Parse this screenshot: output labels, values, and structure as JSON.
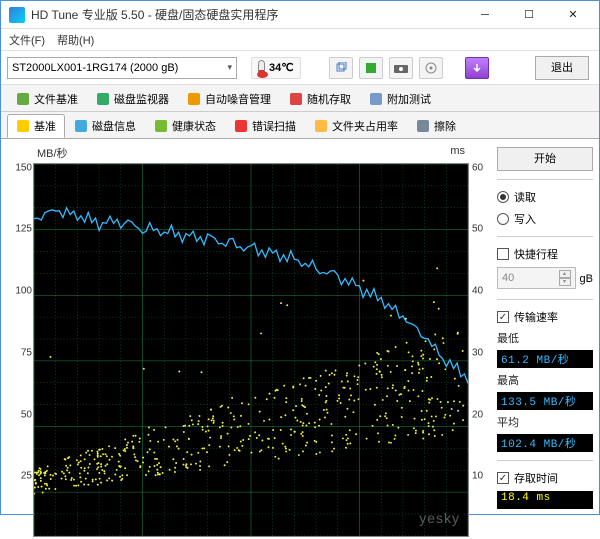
{
  "window": {
    "title": "HD Tune 专业版 5.50 - 硬盘/固态硬盘实用程序"
  },
  "menu": {
    "file": "文件(F)",
    "help": "帮助(H)"
  },
  "toolbar": {
    "drive": "ST2000LX001-1RG174 (2000 gB)",
    "temp": "34℃",
    "exit": "退出"
  },
  "tabs_row1": [
    {
      "label": "文件基准",
      "icon": "file"
    },
    {
      "label": "磁盘监视器",
      "icon": "disk"
    },
    {
      "label": "自动噪音管理",
      "icon": "speaker"
    },
    {
      "label": "随机存取",
      "icon": "random"
    },
    {
      "label": "附加测试",
      "icon": "extra"
    }
  ],
  "tabs_row2": [
    {
      "label": "基准",
      "icon": "bulb",
      "active": true
    },
    {
      "label": "磁盘信息",
      "icon": "info"
    },
    {
      "label": "健康状态",
      "icon": "health"
    },
    {
      "label": "错误扫描",
      "icon": "error"
    },
    {
      "label": "文件夹占用率",
      "icon": "folder"
    },
    {
      "label": "擦除",
      "icon": "erase"
    }
  ],
  "chart": {
    "ylabel_left": "MB/秒",
    "ylabel_right": "ms",
    "yticks_left": [
      150,
      125,
      100,
      75,
      50,
      25
    ],
    "yticks_right": [
      60,
      50,
      40,
      30,
      20,
      10
    ]
  },
  "side": {
    "start": "开始",
    "read": "读取",
    "write": "写入",
    "shortstroke": "快捷行程",
    "stroke_val": "40",
    "stroke_unit": "gB",
    "transfer_rate": "传输速率",
    "min_lbl": "最低",
    "min_val": "61.2 MB/秒",
    "max_lbl": "最高",
    "max_val": "133.5 MB/秒",
    "avg_lbl": "平均",
    "avg_val": "102.4 MB/秒",
    "access_time": "存取时间",
    "access_val": "18.4 ms"
  },
  "chart_data": {
    "type": "line",
    "title": "",
    "xlabel": "",
    "ylabel": "MB/秒",
    "ylim_left": [
      0,
      150
    ],
    "ylim_right": [
      0,
      60
    ],
    "x": [
      0,
      5,
      10,
      15,
      20,
      25,
      30,
      35,
      40,
      45,
      50,
      55,
      60,
      65,
      70,
      75,
      80,
      85,
      90,
      95,
      100
    ],
    "series": [
      {
        "name": "传输速率 (MB/秒)",
        "axis": "left",
        "values": [
          128,
          131,
          129,
          126,
          127,
          124,
          123,
          121,
          120,
          118,
          116,
          114,
          112,
          108,
          105,
          100,
          95,
          88,
          80,
          70,
          64
        ]
      },
      {
        "name": "存取时间 (ms)",
        "axis": "right",
        "type": "scatter",
        "values": [
          9,
          10,
          12,
          11,
          13,
          12,
          14,
          13,
          15,
          14,
          16,
          17,
          16,
          18,
          19,
          20,
          21,
          22,
          21,
          23,
          22
        ]
      }
    ]
  }
}
